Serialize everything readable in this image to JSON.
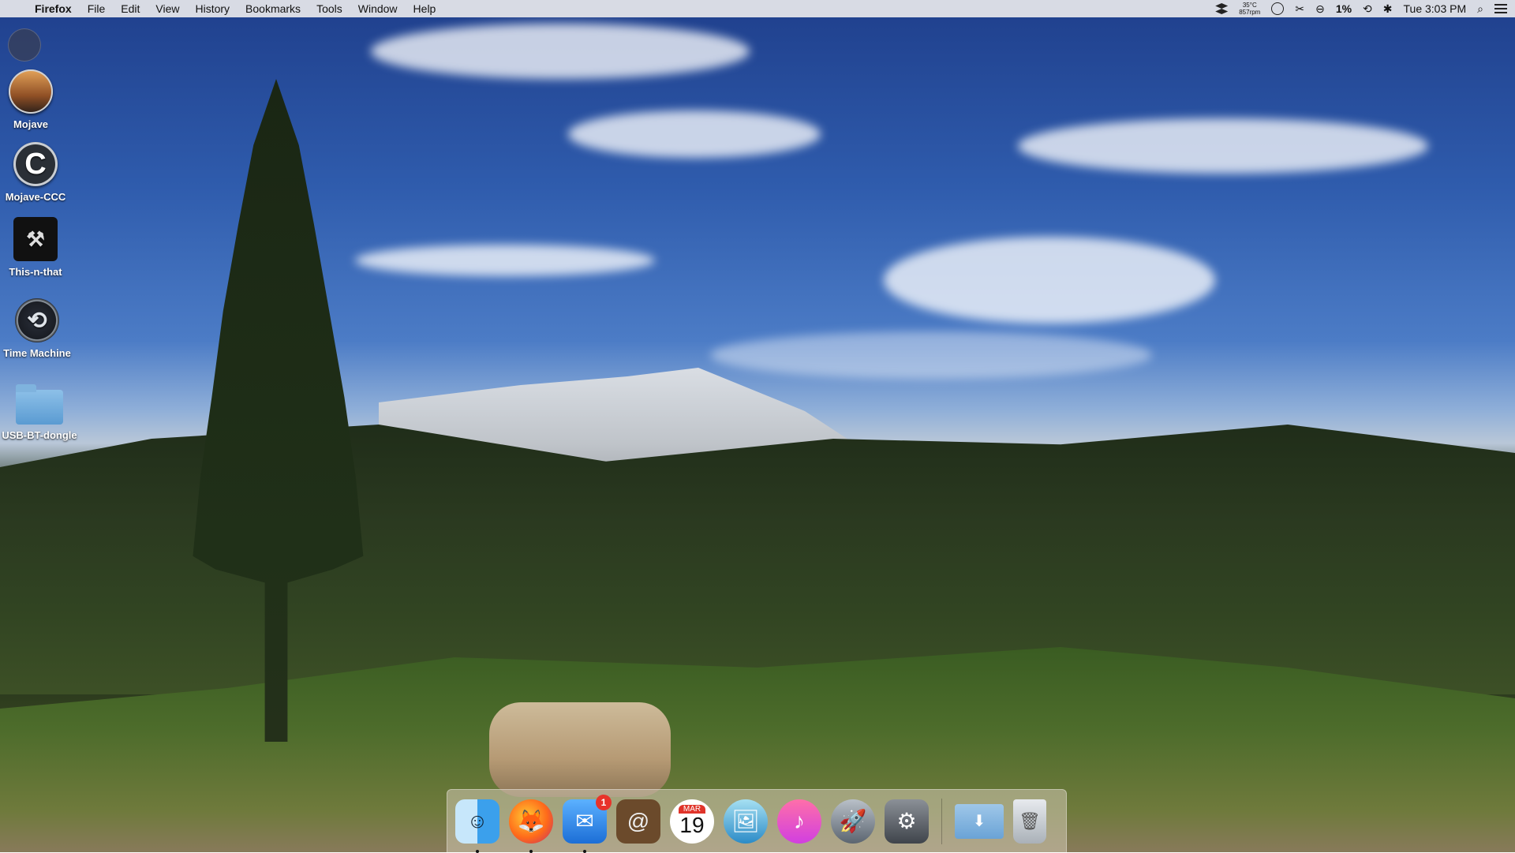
{
  "menubar": {
    "app": "Firefox",
    "menus": [
      "File",
      "Edit",
      "View",
      "History",
      "Bookmarks",
      "Tools",
      "Window",
      "Help"
    ],
    "status": {
      "temp": "35°C",
      "rpm": "857rpm",
      "battery": "1%",
      "clock": "Tue 3:03 PM"
    },
    "icons": [
      "dropbox-icon",
      "circle-status-icon",
      "scissors-icon",
      "no-entry-icon",
      "time-machine-icon",
      "bluetooth-icon",
      "spotlight-icon",
      "notification-center-icon"
    ]
  },
  "desktop": {
    "icons": [
      {
        "label": "Mojave"
      },
      {
        "label": "Mojave-CCC"
      },
      {
        "label": "This-n-that"
      },
      {
        "label": "Time Machine"
      },
      {
        "label": "USB-BT-dongle"
      }
    ]
  },
  "dock": {
    "apps": [
      "Finder",
      "Firefox",
      "Mail",
      "Contacts",
      "Calendar",
      "Preview",
      "iTunes",
      "Launchpad",
      "System Preferences"
    ],
    "mail_badge": "1",
    "calendar_month": "MAR",
    "calendar_day": "19",
    "folders": [
      "Downloads",
      "Trash"
    ]
  }
}
